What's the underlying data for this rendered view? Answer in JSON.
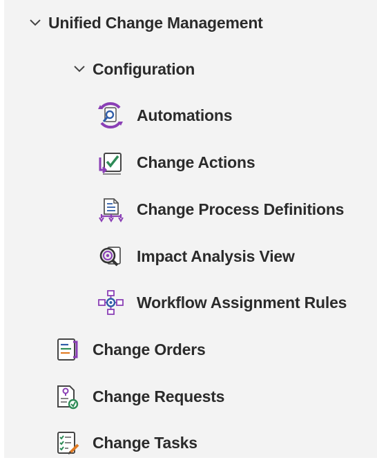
{
  "tree": {
    "root": {
      "label": "Unified Change Management",
      "expanded": true,
      "icon": "chevron-down-icon"
    },
    "configuration": {
      "label": "Configuration",
      "expanded": true,
      "icon": "chevron-down-icon",
      "items": [
        {
          "label": "Automations",
          "icon": "automations-icon"
        },
        {
          "label": "Change Actions",
          "icon": "change-actions-icon"
        },
        {
          "label": "Change Process Definitions",
          "icon": "process-definitions-icon"
        },
        {
          "label": "Impact Analysis View",
          "icon": "impact-analysis-icon"
        },
        {
          "label": "Workflow Assignment Rules",
          "icon": "workflow-rules-icon"
        }
      ]
    },
    "items": [
      {
        "label": "Change Orders",
        "icon": "change-orders-icon"
      },
      {
        "label": "Change Requests",
        "icon": "change-requests-icon"
      },
      {
        "label": "Change Tasks",
        "icon": "change-tasks-icon"
      }
    ]
  },
  "colors": {
    "panel_bg": "#f3f3f3",
    "text": "#2b2b2b",
    "purple": "#7b3fb4",
    "blue": "#2f5da8",
    "green": "#2e8b57",
    "orange": "#e07b24"
  }
}
